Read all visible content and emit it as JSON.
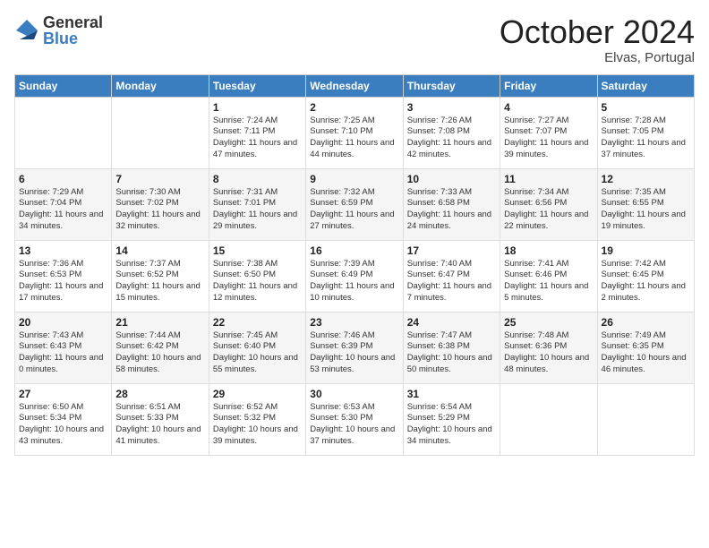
{
  "logo": {
    "general": "General",
    "blue": "Blue"
  },
  "title": "October 2024",
  "location": "Elvas, Portugal",
  "headers": [
    "Sunday",
    "Monday",
    "Tuesday",
    "Wednesday",
    "Thursday",
    "Friday",
    "Saturday"
  ],
  "weeks": [
    [
      {
        "day": "",
        "info": ""
      },
      {
        "day": "",
        "info": ""
      },
      {
        "day": "1",
        "info": "Sunrise: 7:24 AM\nSunset: 7:11 PM\nDaylight: 11 hours and 47 minutes."
      },
      {
        "day": "2",
        "info": "Sunrise: 7:25 AM\nSunset: 7:10 PM\nDaylight: 11 hours and 44 minutes."
      },
      {
        "day": "3",
        "info": "Sunrise: 7:26 AM\nSunset: 7:08 PM\nDaylight: 11 hours and 42 minutes."
      },
      {
        "day": "4",
        "info": "Sunrise: 7:27 AM\nSunset: 7:07 PM\nDaylight: 11 hours and 39 minutes."
      },
      {
        "day": "5",
        "info": "Sunrise: 7:28 AM\nSunset: 7:05 PM\nDaylight: 11 hours and 37 minutes."
      }
    ],
    [
      {
        "day": "6",
        "info": "Sunrise: 7:29 AM\nSunset: 7:04 PM\nDaylight: 11 hours and 34 minutes."
      },
      {
        "day": "7",
        "info": "Sunrise: 7:30 AM\nSunset: 7:02 PM\nDaylight: 11 hours and 32 minutes."
      },
      {
        "day": "8",
        "info": "Sunrise: 7:31 AM\nSunset: 7:01 PM\nDaylight: 11 hours and 29 minutes."
      },
      {
        "day": "9",
        "info": "Sunrise: 7:32 AM\nSunset: 6:59 PM\nDaylight: 11 hours and 27 minutes."
      },
      {
        "day": "10",
        "info": "Sunrise: 7:33 AM\nSunset: 6:58 PM\nDaylight: 11 hours and 24 minutes."
      },
      {
        "day": "11",
        "info": "Sunrise: 7:34 AM\nSunset: 6:56 PM\nDaylight: 11 hours and 22 minutes."
      },
      {
        "day": "12",
        "info": "Sunrise: 7:35 AM\nSunset: 6:55 PM\nDaylight: 11 hours and 19 minutes."
      }
    ],
    [
      {
        "day": "13",
        "info": "Sunrise: 7:36 AM\nSunset: 6:53 PM\nDaylight: 11 hours and 17 minutes."
      },
      {
        "day": "14",
        "info": "Sunrise: 7:37 AM\nSunset: 6:52 PM\nDaylight: 11 hours and 15 minutes."
      },
      {
        "day": "15",
        "info": "Sunrise: 7:38 AM\nSunset: 6:50 PM\nDaylight: 11 hours and 12 minutes."
      },
      {
        "day": "16",
        "info": "Sunrise: 7:39 AM\nSunset: 6:49 PM\nDaylight: 11 hours and 10 minutes."
      },
      {
        "day": "17",
        "info": "Sunrise: 7:40 AM\nSunset: 6:47 PM\nDaylight: 11 hours and 7 minutes."
      },
      {
        "day": "18",
        "info": "Sunrise: 7:41 AM\nSunset: 6:46 PM\nDaylight: 11 hours and 5 minutes."
      },
      {
        "day": "19",
        "info": "Sunrise: 7:42 AM\nSunset: 6:45 PM\nDaylight: 11 hours and 2 minutes."
      }
    ],
    [
      {
        "day": "20",
        "info": "Sunrise: 7:43 AM\nSunset: 6:43 PM\nDaylight: 11 hours and 0 minutes."
      },
      {
        "day": "21",
        "info": "Sunrise: 7:44 AM\nSunset: 6:42 PM\nDaylight: 10 hours and 58 minutes."
      },
      {
        "day": "22",
        "info": "Sunrise: 7:45 AM\nSunset: 6:40 PM\nDaylight: 10 hours and 55 minutes."
      },
      {
        "day": "23",
        "info": "Sunrise: 7:46 AM\nSunset: 6:39 PM\nDaylight: 10 hours and 53 minutes."
      },
      {
        "day": "24",
        "info": "Sunrise: 7:47 AM\nSunset: 6:38 PM\nDaylight: 10 hours and 50 minutes."
      },
      {
        "day": "25",
        "info": "Sunrise: 7:48 AM\nSunset: 6:36 PM\nDaylight: 10 hours and 48 minutes."
      },
      {
        "day": "26",
        "info": "Sunrise: 7:49 AM\nSunset: 6:35 PM\nDaylight: 10 hours and 46 minutes."
      }
    ],
    [
      {
        "day": "27",
        "info": "Sunrise: 6:50 AM\nSunset: 5:34 PM\nDaylight: 10 hours and 43 minutes."
      },
      {
        "day": "28",
        "info": "Sunrise: 6:51 AM\nSunset: 5:33 PM\nDaylight: 10 hours and 41 minutes."
      },
      {
        "day": "29",
        "info": "Sunrise: 6:52 AM\nSunset: 5:32 PM\nDaylight: 10 hours and 39 minutes."
      },
      {
        "day": "30",
        "info": "Sunrise: 6:53 AM\nSunset: 5:30 PM\nDaylight: 10 hours and 37 minutes."
      },
      {
        "day": "31",
        "info": "Sunrise: 6:54 AM\nSunset: 5:29 PM\nDaylight: 10 hours and 34 minutes."
      },
      {
        "day": "",
        "info": ""
      },
      {
        "day": "",
        "info": ""
      }
    ]
  ]
}
